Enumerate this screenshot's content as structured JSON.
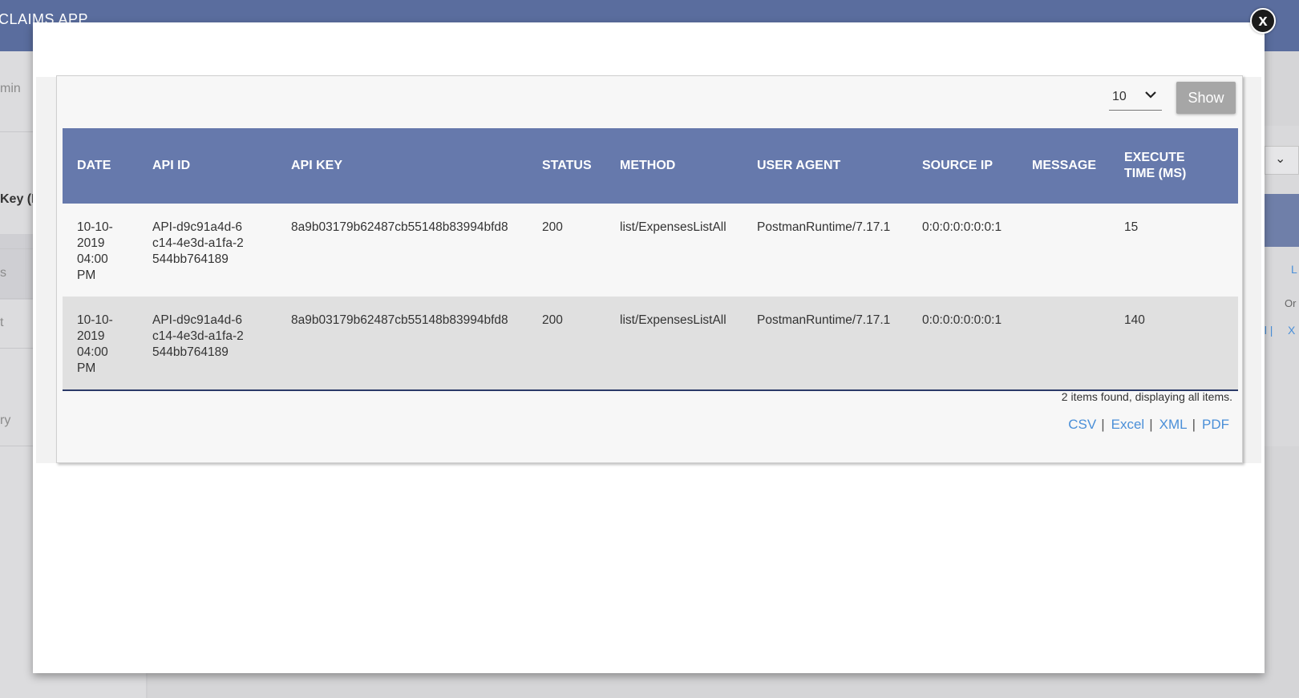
{
  "app": {
    "title": "CLAIMS APP"
  },
  "background": {
    "sidebar_fragments": [
      "min",
      "Key (E",
      "s",
      "t",
      "ry"
    ],
    "right_fragments": [
      "L",
      "Or",
      "el |",
      "X"
    ]
  },
  "modal": {
    "close_label": "x",
    "page_size": {
      "selected": "10",
      "options": [
        "10"
      ]
    },
    "show_label": "Show",
    "table": {
      "columns": [
        "DATE",
        "API ID",
        "API KEY",
        "STATUS",
        "METHOD",
        "USER AGENT",
        "SOURCE IP",
        "MESSAGE",
        "EXECUTE TIME (MS)"
      ],
      "rows": [
        [
          "10-10-2019 04:00 PM",
          "API-d9c91a4d-6c14-4e3d-a1fa-2544bb764189",
          "8a9b03179b62487cb55148b83994bfd8",
          "200",
          "list/ExpensesListAll",
          "PostmanRuntime/7.17.1",
          "0:0:0:0:0:0:0:1",
          "",
          "15"
        ],
        [
          "10-10-2019 04:00 PM",
          "API-d9c91a4d-6c14-4e3d-a1fa-2544bb764189",
          "8a9b03179b62487cb55148b83994bfd8",
          "200",
          "list/ExpensesListAll",
          "PostmanRuntime/7.17.1",
          "0:0:0:0:0:0:0:1",
          "",
          "140"
        ]
      ]
    },
    "items_found": "2 items found, displaying all items.",
    "exports": [
      "CSV",
      "Excel",
      "XML",
      "PDF"
    ]
  },
  "colors": {
    "header_bg": "#5a6d9e",
    "table_header_bg": "#6679ac",
    "link": "#4a8fd8",
    "button_bg": "#a6a6a6"
  }
}
